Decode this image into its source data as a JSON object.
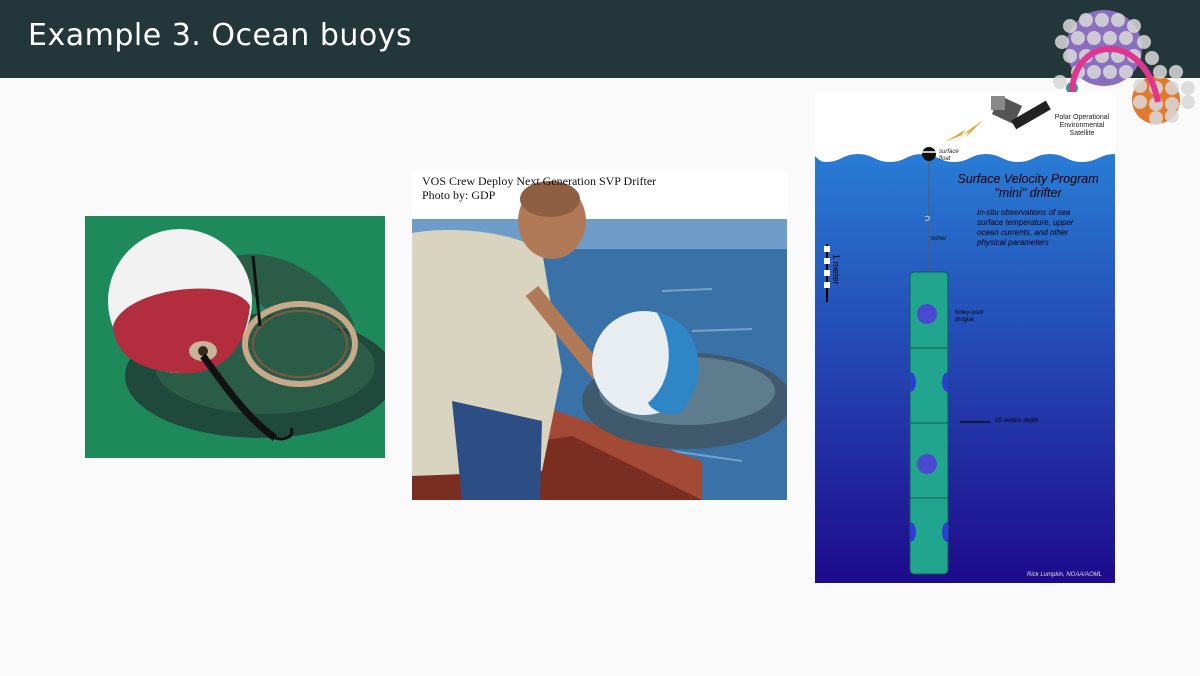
{
  "slide": {
    "title": "Example 3. Ocean buoys"
  },
  "photo_deploy": {
    "caption_line1": "VOS Crew Deploy Next Generation SVP Drifter",
    "caption_line2": "Photo by: GDP"
  },
  "diagram": {
    "satellite_label_1": "Polar Operational",
    "satellite_label_2": "Environmental",
    "satellite_label_3": "Satellite",
    "surface_float_1": "surface",
    "surface_float_2": "float",
    "program_title_1": "Surface Velocity Program",
    "program_title_2": "\"mini\" drifter",
    "desc_1": "In-situ observations of sea",
    "desc_2": "surface temperature, upper",
    "desc_3": "ocean currents, and other",
    "desc_4": "physical parameters",
    "tether_label": "tether",
    "scale_label": "1 meter",
    "drogue_label_1": "holey-sock",
    "drogue_label_2": "drogue",
    "depth_label": "15 meters depth",
    "credit": "Rick Lumpkin, NOAA/AOML"
  },
  "colors": {
    "header_bg": "#23373b",
    "logo_purple": "#8a6fbf",
    "logo_orange": "#e07a2e",
    "logo_pink": "#e0368f",
    "logo_teal": "#2aa198"
  }
}
